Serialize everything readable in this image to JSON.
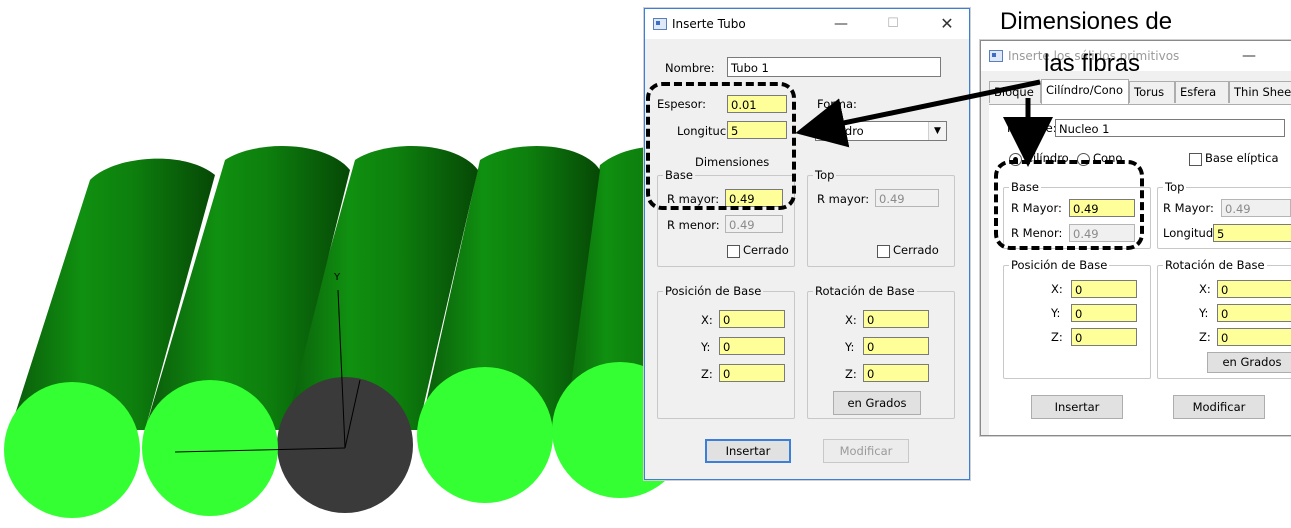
{
  "annotation": {
    "line1": "Dimensiones de",
    "line2": "las fibras"
  },
  "viewport": {
    "axis_y_label": "Y",
    "colors": {
      "fiber_body": "#0b7a0b",
      "fiber_face": "#33ff33",
      "selected_face": "#3a3a3a"
    }
  },
  "dialog1": {
    "title": "Inserte Tubo",
    "nombre_label": "Nombre:",
    "nombre_value": "Tubo 1",
    "espesor_label": "Espesor:",
    "espesor_value": "0.01",
    "longitud_label": "Longituc",
    "longitud_value": "5",
    "forma_label": "Forma:",
    "forma_value": "Cilindro",
    "dimensiones_label": "Dimensiones",
    "base": {
      "title": "Base",
      "rmayor_label": "R mayor:",
      "rmayor_value": "0.49",
      "rmenor_label": "R menor:",
      "rmenor_value": "0.49",
      "cerrado_label": "Cerrado"
    },
    "top": {
      "title": "Top",
      "rmayor_label": "R mayor:",
      "rmayor_value": "0.49",
      "cerrado_label": "Cerrado"
    },
    "posicion": {
      "title": "Posición de Base",
      "x_label": "X:",
      "x_value": "0",
      "y_label": "Y:",
      "y_value": "0",
      "z_label": "Z:",
      "z_value": "0"
    },
    "rotacion": {
      "title": "Rotación de Base",
      "x_label": "X:",
      "x_value": "0",
      "y_label": "Y:",
      "y_value": "0",
      "z_label": "Z:",
      "z_value": "0",
      "grados_label": "en Grados"
    },
    "insertar_label": "Insertar",
    "modificar_label": "Modificar"
  },
  "dialog2": {
    "title": "Inserte los sólidos primitivos",
    "tabs": [
      "Bloque",
      "Cilíndro/Cono",
      "Torus",
      "Esfera",
      "Thin Sheet"
    ],
    "nombre_label": "Nombre:",
    "nombre_value": "Nucleo 1",
    "cilindro_label": "Cilíndro",
    "cono_label": "Cono",
    "base_eliptica_label": "Base elíptica",
    "base": {
      "title": "Base",
      "rmayor_label": "R Mayor:",
      "rmayor_value": "0.49",
      "rmenor_label": "R Menor:",
      "rmenor_value": "0.49"
    },
    "top": {
      "title": "Top",
      "rmayor_label": "R Mayor:",
      "rmayor_value": "0.49",
      "longitud_label": "Longitud",
      "longitud_value": "5"
    },
    "posicion": {
      "title": "Posición de Base",
      "x_label": "X:",
      "x_value": "0",
      "y_label": "Y:",
      "y_value": "0",
      "z_label": "Z:",
      "z_value": "0"
    },
    "rotacion": {
      "title": "Rotación de Base",
      "x_label": "X:",
      "x_value": "0",
      "y_label": "Y:",
      "y_value": "0",
      "z_label": "Z:",
      "z_value": "0",
      "grados_label": "en Grados"
    },
    "insertar_label": "Insertar",
    "modificar_label": "Modificar"
  }
}
